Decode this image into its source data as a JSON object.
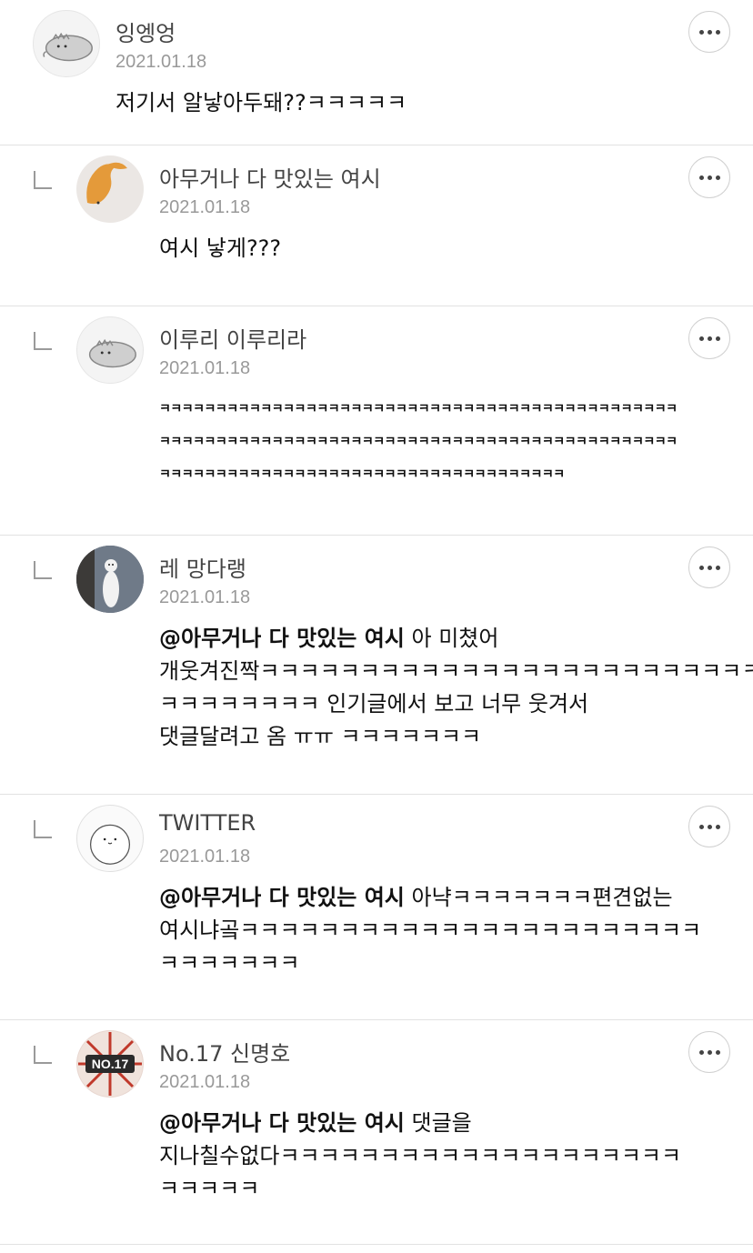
{
  "comments": [
    {
      "author": "잉엥엉",
      "date": "2021.01.18",
      "lines": [
        "저기서 알낳아두돼??ㅋㅋㅋㅋㅋ"
      ],
      "avatar_icon": "dinosaur-avatar-icon"
    },
    {
      "author": "아무거나 다 맛있는 여시",
      "date": "2021.01.18",
      "lines": [
        "여시 낳게???"
      ],
      "avatar_icon": "fox-avatar-icon"
    },
    {
      "author": "이루리 이루리라",
      "date": "2021.01.18",
      "lines": [
        "ㅋㅋㅋㅋㅋㅋㅋㅋㅋㅋㅋㅋㅋㅋㅋㅋㅋㅋㅋㅋㅋㅋㅋㅋㅋㅋㅋㅋㅋㅋㅋㅋㅋㅋㅋㅋㅋㅋㅋㅋㅋㅋㅋㅋㅋㅋ",
        "ㅋㅋㅋㅋㅋㅋㅋㅋㅋㅋㅋㅋㅋㅋㅋㅋㅋㅋㅋㅋㅋㅋㅋㅋㅋㅋㅋㅋㅋㅋㅋㅋㅋㅋㅋㅋㅋㅋㅋㅋㅋㅋㅋㅋㅋㅋ",
        "ㅋㅋㅋㅋㅋㅋㅋㅋㅋㅋㅋㅋㅋㅋㅋㅋㅋㅋㅋㅋㅋㅋㅋㅋㅋㅋㅋㅋㅋㅋㅋㅋㅋㅋㅋㅋ"
      ],
      "avatar_icon": "dinosaur-avatar-icon"
    },
    {
      "author": "레 망다랭",
      "date": "2021.01.18",
      "mention": "@아무거나 다 맛있는 여시",
      "first_line_rest": " 아 미쳤어",
      "lines": [
        "개웃겨진짝ㅋㅋㅋㅋㅋㅋㅋㅋㅋㅋㅋㅋㅋㅋㅋㅋㅋㅋㅋㅋㅋㅋㅋㅋㅋ",
        "ㅋㅋㅋㅋㅋㅋㅋㅋ 인기글에서 보고 너무 웃겨서",
        "댓글달려고 옴 ㅠㅠ ㅋㅋㅋㅋㅋㅋㅋ"
      ],
      "avatar_icon": "ermine-photo-avatar-icon"
    },
    {
      "author": "TWITTER",
      "date": "2021.01.18",
      "mention": "@아무거나 다 맛있는 여시",
      "first_line_rest": " 아냑ㅋㅋㅋㅋㅋㅋㅋ편견없는",
      "lines": [
        "여시냐곸ㅋㅋㅋㅋㅋㅋㅋㅋㅋㅋㅋㅋㅋㅋㅋㅋㅋㅋㅋㅋㅋㅋㅋ",
        "ㅋㅋㅋㅋㅋㅋㅋ"
      ],
      "avatar_icon": "seal-avatar-icon"
    },
    {
      "author": "No.17 신명호",
      "date": "2021.01.18",
      "mention": "@아무거나 다 맛있는 여시",
      "first_line_rest": " 댓글을",
      "lines": [
        "지나칠수없다ㅋㅋㅋㅋㅋㅋㅋㅋㅋㅋㅋㅋㅋㅋㅋㅋㅋㅋㅋㅋ",
        "ㅋㅋㅋㅋㅋ"
      ],
      "avatar_icon": "no17-logo-avatar-icon",
      "avatar_text": "NO.17"
    }
  ]
}
